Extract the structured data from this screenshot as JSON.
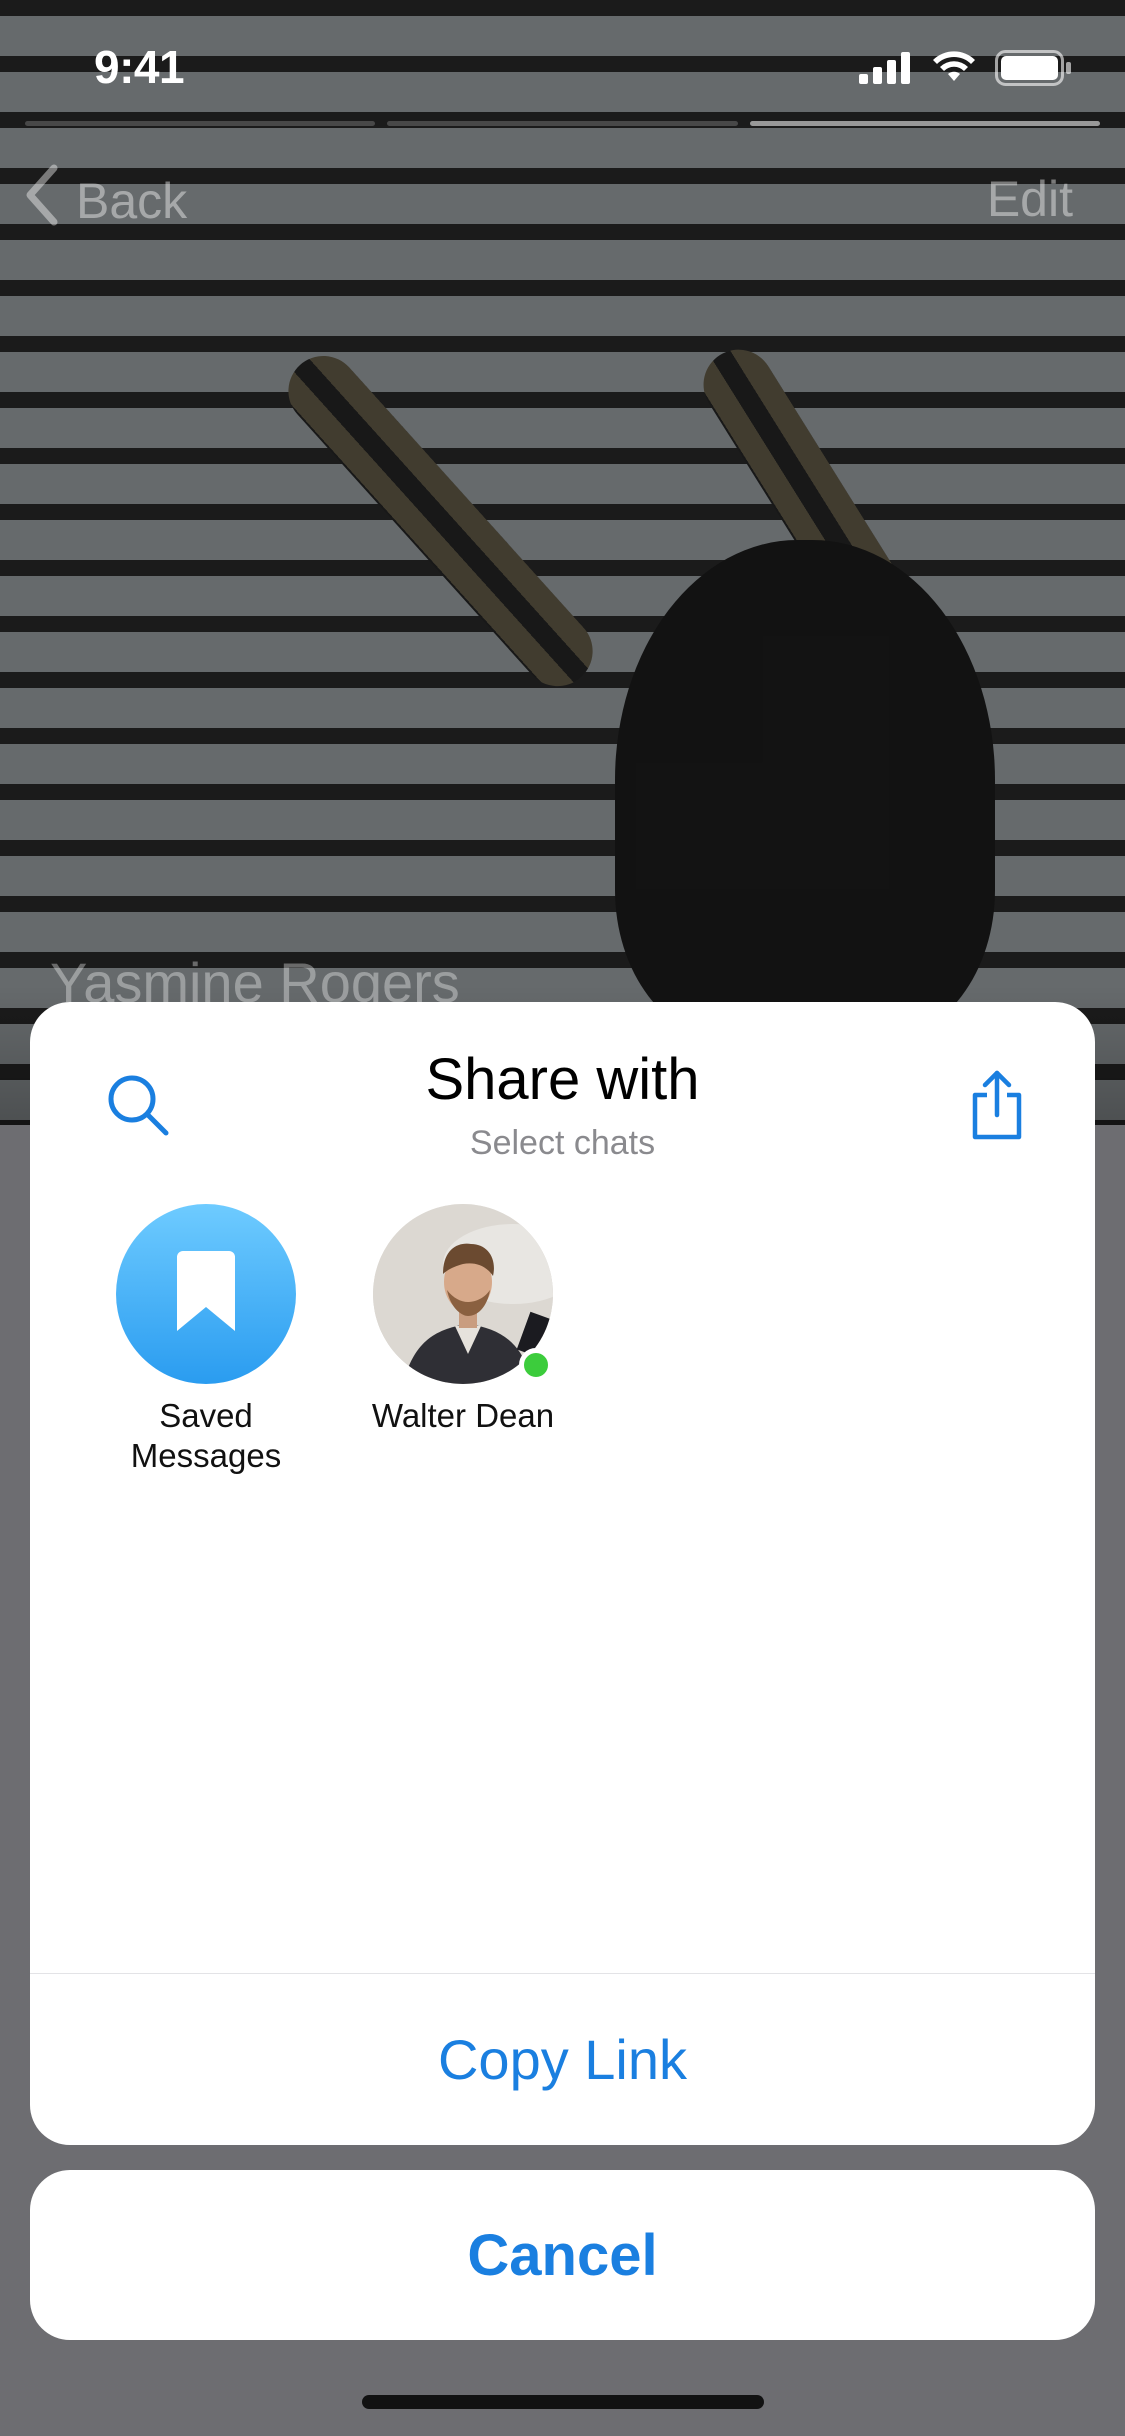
{
  "status_bar": {
    "time": "9:41"
  },
  "navigation": {
    "back_label": "Back",
    "edit_label": "Edit"
  },
  "profile": {
    "name": "Yasmine Rogers"
  },
  "share_sheet": {
    "title": "Share with",
    "subtitle": "Select chats",
    "search_icon": "search-icon",
    "share_icon": "share-icon",
    "contacts": [
      {
        "label": "Saved\nMessages",
        "icon": "bookmark-icon"
      },
      {
        "label": "Walter Dean",
        "online": true
      }
    ],
    "copy_link_label": "Copy Link"
  },
  "cancel_label": "Cancel",
  "colors": {
    "accent": "#1a7fe0",
    "online": "#3ccc3c",
    "saved_gradient_top": "#6ecbff",
    "saved_gradient_bottom": "#2a9cf0",
    "dim_overlay": "#6d6d71"
  }
}
